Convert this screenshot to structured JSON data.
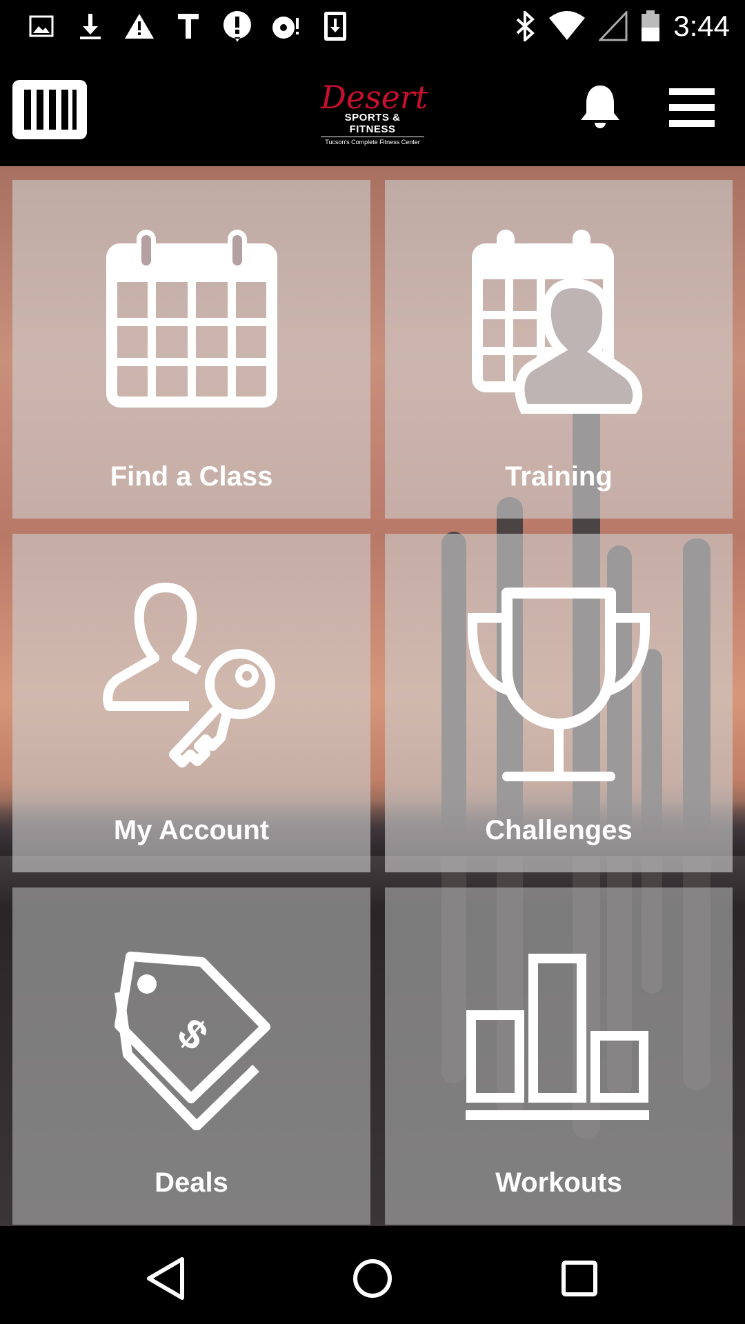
{
  "status_bar": {
    "time": "3:44",
    "left_icons": [
      "image-icon",
      "download-icon",
      "warning-icon",
      "text-icon",
      "alert-icon",
      "sync-icon",
      "sim-download-icon"
    ],
    "right_icons": [
      "bluetooth-icon",
      "wifi-icon",
      "signal-icon",
      "battery-icon"
    ]
  },
  "app_bar": {
    "logo": {
      "script": "Desert",
      "line1": "SPORTS & FITNESS",
      "line2": "Tucson's Complete Fitness Center"
    }
  },
  "tiles": [
    {
      "label": "Find a Class",
      "icon": "calendar-icon"
    },
    {
      "label": "Training",
      "icon": "calendar-person-icon"
    },
    {
      "label": "My Account",
      "icon": "person-key-icon"
    },
    {
      "label": "Challenges",
      "icon": "trophy-icon"
    },
    {
      "label": "Deals",
      "icon": "price-tag-icon"
    },
    {
      "label": "Workouts",
      "icon": "bar-chart-icon"
    }
  ],
  "colors": {
    "brand_red": "#c8102e",
    "tile_overlay": "rgba(205,205,205,0.62)"
  }
}
